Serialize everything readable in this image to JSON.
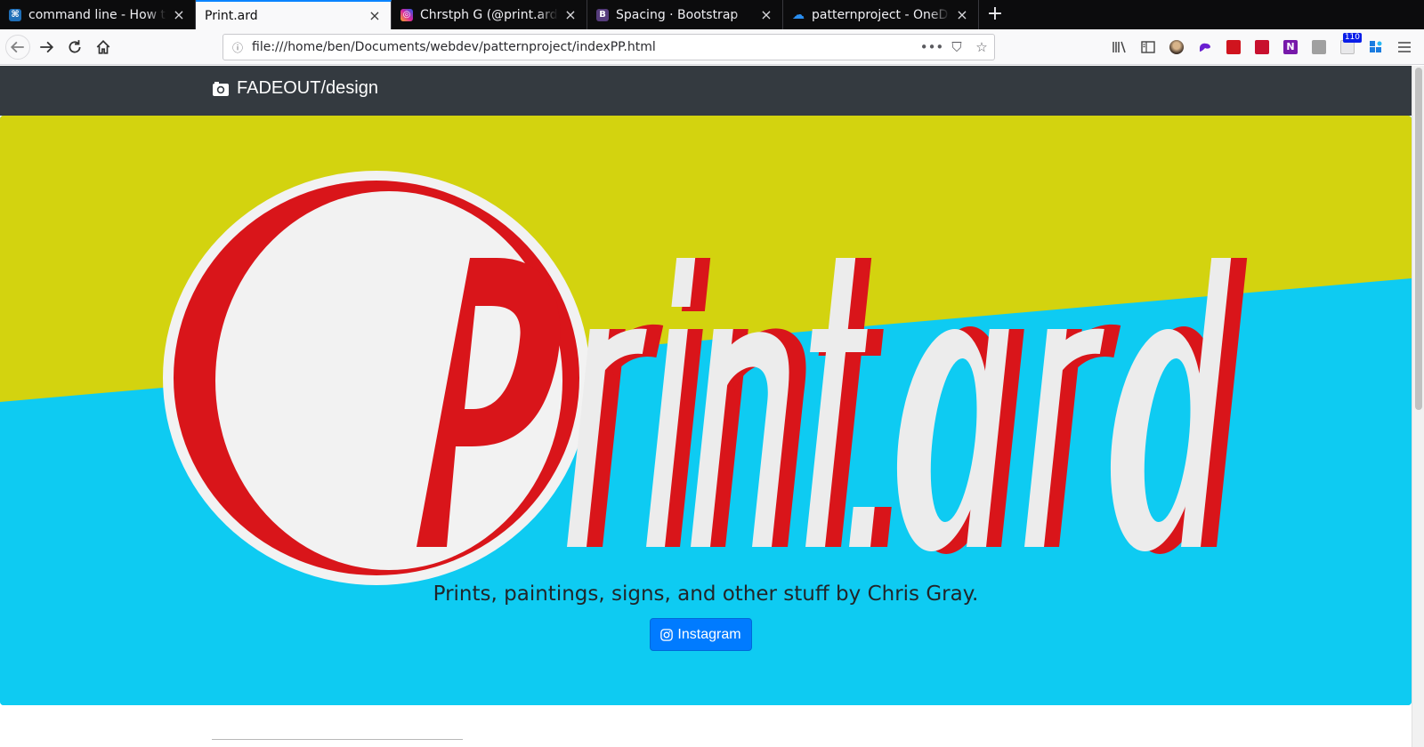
{
  "browser": {
    "tabs": [
      {
        "title": "command line - How to c",
        "favicon_color": "#1f6fb8",
        "favicon_glyph": "⌘",
        "active": false
      },
      {
        "title": "Print.ard",
        "favicon_color": "",
        "favicon_glyph": "",
        "active": true
      },
      {
        "title": "Chrstph G (@print.ard) •",
        "favicon_color": "#d6249f",
        "favicon_glyph": "◎",
        "active": false
      },
      {
        "title": "Spacing · Bootstrap",
        "favicon_color": "#563d7c",
        "favicon_glyph": "B",
        "active": false
      },
      {
        "title": "patternproject - OneDriv",
        "favicon_color": "#0078d4",
        "favicon_glyph": "☁",
        "active": false
      }
    ],
    "new_tab_label": "+",
    "close_glyph": "×",
    "url": "file:///home/ben/Documents/webdev/patternproject/indexPP.html",
    "url_actions": {
      "more": "•••",
      "pocket": "⛉",
      "bookmark": "☆"
    },
    "badge_count": "110",
    "extension_colors": [
      "#555555",
      "#7a5230",
      "#6a1fd1",
      "#d0141e",
      "#c8102e",
      "#7719aa",
      "#9e9e9e",
      "#cc2244",
      "#1b7ce0"
    ]
  },
  "site": {
    "brand": "FADEOUT/design",
    "brand_icon": "camera-icon",
    "logo_text": "Print.ard",
    "tagline": "Prints, paintings, signs, and other stuff by Chris Gray.",
    "button_label": "Instagram",
    "button_icon": "instagram-icon",
    "colors": {
      "navbar": "#343a40",
      "hero_yellow": "#d3d30f",
      "hero_cyan": "#0ecbf2",
      "logo_red": "#d9151a",
      "logo_white": "#f2f2f2",
      "button": "#007bff"
    }
  }
}
